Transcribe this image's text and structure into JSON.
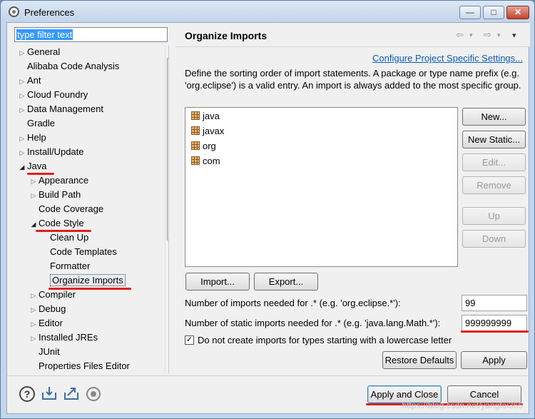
{
  "window": {
    "title": "Preferences",
    "buttons": {
      "minimize": "—",
      "maximize": "□",
      "close": "✕"
    }
  },
  "filter": {
    "value": "type filter text"
  },
  "tree": {
    "items": [
      {
        "label": "General",
        "toggle": "▷"
      },
      {
        "label": "Alibaba Code Analysis",
        "toggle": ""
      },
      {
        "label": "Ant",
        "toggle": "▷"
      },
      {
        "label": "Cloud Foundry",
        "toggle": "▷"
      },
      {
        "label": "Data Management",
        "toggle": "▷"
      },
      {
        "label": "Gradle",
        "toggle": ""
      },
      {
        "label": "Help",
        "toggle": "▷"
      },
      {
        "label": "Install/Update",
        "toggle": "▷"
      },
      {
        "label": "Java",
        "toggle": "◢"
      },
      {
        "label": "Appearance",
        "toggle": "▷"
      },
      {
        "label": "Build Path",
        "toggle": "▷"
      },
      {
        "label": "Code Coverage",
        "toggle": ""
      },
      {
        "label": "Code Style",
        "toggle": "◢"
      },
      {
        "label": "Clean Up",
        "toggle": ""
      },
      {
        "label": "Code Templates",
        "toggle": ""
      },
      {
        "label": "Formatter",
        "toggle": ""
      },
      {
        "label": "Organize Imports",
        "toggle": ""
      },
      {
        "label": "Compiler",
        "toggle": "▷"
      },
      {
        "label": "Debug",
        "toggle": "▷"
      },
      {
        "label": "Editor",
        "toggle": "▷"
      },
      {
        "label": "Installed JREs",
        "toggle": "▷"
      },
      {
        "label": "JUnit",
        "toggle": ""
      },
      {
        "label": "Properties Files Editor",
        "toggle": ""
      }
    ]
  },
  "page": {
    "title": "Organize Imports",
    "nav": {
      "back": "⇦",
      "forward": "⇨",
      "menu": "▾"
    },
    "config_link": "Configure Project Specific Settings...",
    "description": "Define the sorting order of import statements. A package or type name prefix (e.g. 'org.eclipse') is a valid entry. An import is always added to the most specific group.",
    "imports": [
      "java",
      "javax",
      "org",
      "com"
    ],
    "buttons": {
      "new": "New...",
      "new_static": "New Static...",
      "edit": "Edit...",
      "remove": "Remove",
      "up": "Up",
      "down": "Down",
      "import": "Import...",
      "export": "Export..."
    },
    "imports_threshold_label": "Number of imports needed for .* (e.g. 'org.eclipse.*'):",
    "imports_threshold_value": "99",
    "static_threshold_label": "Number of static imports needed for .* (e.g. 'java.lang.Math.*'):",
    "static_threshold_value": "999999999",
    "lowercase_checkbox_label": "Do not create imports for types starting with a lowercase letter",
    "lowercase_checked": "✓",
    "restore_defaults": "Restore Defaults",
    "apply": "Apply"
  },
  "footer": {
    "apply_close": "Apply and Close",
    "cancel": "Cancel",
    "help_icon": "?",
    "watermark": "https://blog.csdn.net/yangfei365"
  },
  "colors": {
    "highlight": "#3399ff",
    "annotation": "#e0201a",
    "link": "#0b5db3"
  }
}
